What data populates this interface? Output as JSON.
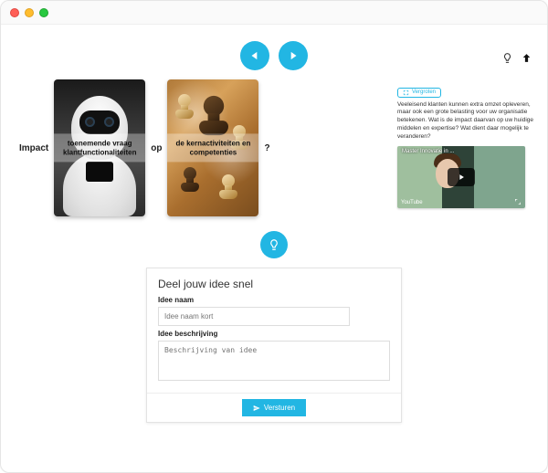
{
  "nav": {
    "prev_icon": "triangle-left",
    "next_icon": "triangle-right"
  },
  "top": {
    "hint_icon": "lightbulb",
    "up_icon": "arrow-up"
  },
  "row": {
    "impact_label": "Impact",
    "op_label": "op",
    "question_label": "?",
    "card1_caption": "toenemende vraag klantfunctionaliteiten",
    "card2_caption": "de kernactiviteiten en competenties"
  },
  "info": {
    "enlarge_label": "Vergroten",
    "body": "Veeleisend klanten kunnen extra omzet opleveren, maar ook een grote belasting voor uw organisatie betekenen. Wat is de impact daarvan op uw huidige middelen en expertise? Wat dient daar mogelijk te veranderen?",
    "video_title": "Master Innovatie in ...",
    "video_platform": "YouTube"
  },
  "idea": {
    "bulb_icon": "lightbulb",
    "heading": "Deel jouw idee snel",
    "name_label": "Idee naam",
    "name_placeholder": "Idee naam kort",
    "desc_label": "Idee beschrijving",
    "desc_placeholder": "Beschrijving van idee",
    "submit_label": "Versturen"
  }
}
